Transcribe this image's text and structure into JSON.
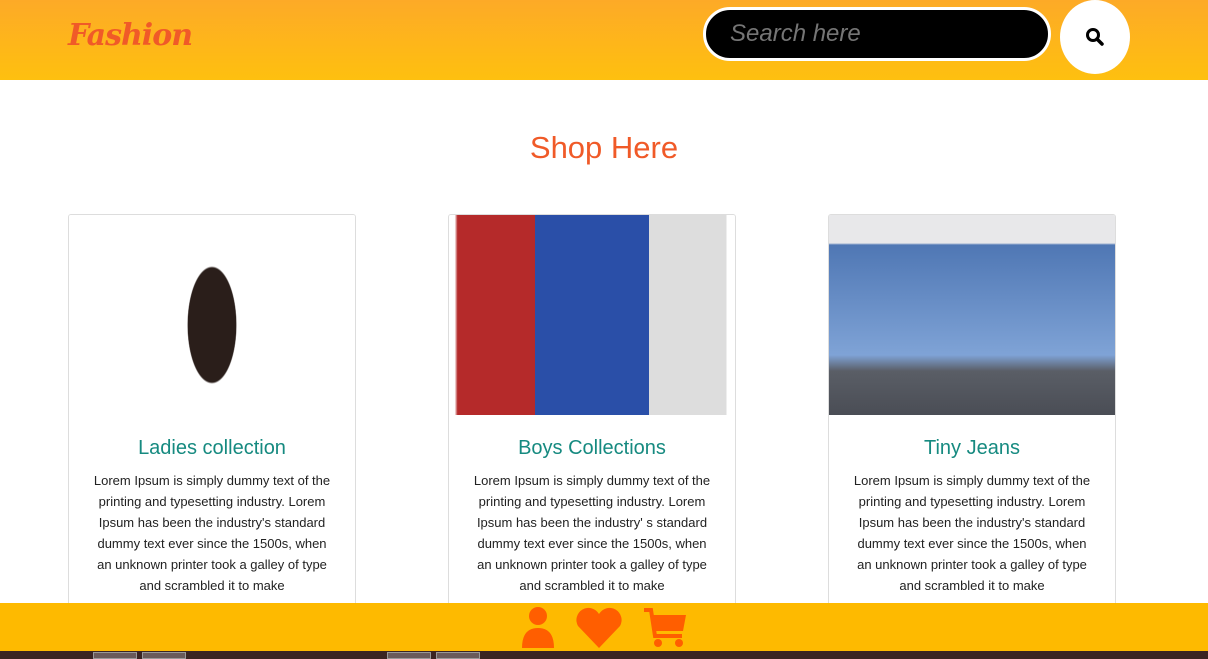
{
  "header": {
    "logo": "Fashion",
    "search_placeholder": "Search here"
  },
  "main": {
    "title": "Shop Here",
    "cards": [
      {
        "title": "Ladies collection",
        "text": "Lorem Ipsum is simply dummy text of the printing and typesetting industry. Lorem Ipsum has been the industry's standard dummy text ever since the 1500s, when an unknown printer took a galley of type and scrambled it to make"
      },
      {
        "title": "Boys Collections",
        "text": "Lorem Ipsum is simply dummy text of the printing and typesetting industry. Lorem Ipsum has been the industry' s standard dummy text ever since the 1500s, when an unknown printer took a galley of type and scrambled it to make"
      },
      {
        "title": "Tiny Jeans",
        "text": "Lorem Ipsum is simply dummy text of the printing and typesetting industry. Lorem Ipsum has been the industry's standard dummy text ever since the 1500s, when an unknown printer took a galley of type and scrambled it to make"
      }
    ]
  },
  "footer": {
    "icons": [
      "user-icon",
      "heart-icon",
      "cart-icon"
    ],
    "icon_color": "#ff5e00"
  }
}
